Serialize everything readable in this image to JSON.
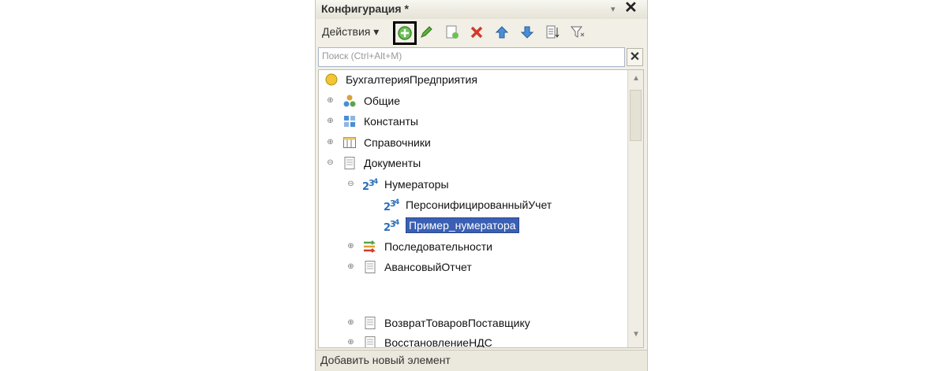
{
  "window": {
    "title": "Конфигурация *"
  },
  "toolbar": {
    "actions_label": "Действия"
  },
  "search": {
    "placeholder": "Поиск (Ctrl+Alt+M)"
  },
  "tree": {
    "root": "БухгалтерияПредприятия",
    "items": [
      {
        "label": "Общие"
      },
      {
        "label": "Константы"
      },
      {
        "label": "Справочники"
      },
      {
        "label": "Документы"
      },
      {
        "label": "Нумераторы"
      },
      {
        "label": "ПерсонифицированныйУчет"
      },
      {
        "label": "Пример_нумератора"
      },
      {
        "label": "Последовательности"
      },
      {
        "label": "АвансовыйОтчет"
      },
      {
        "label": "ВозвратТоваровПоставщику"
      },
      {
        "label": "ВосстановлениеНДС"
      }
    ]
  },
  "status": {
    "text": "Добавить новый элемент"
  },
  "colors": {
    "selection": "#3a5fb3",
    "panel": "#f1efe6"
  }
}
